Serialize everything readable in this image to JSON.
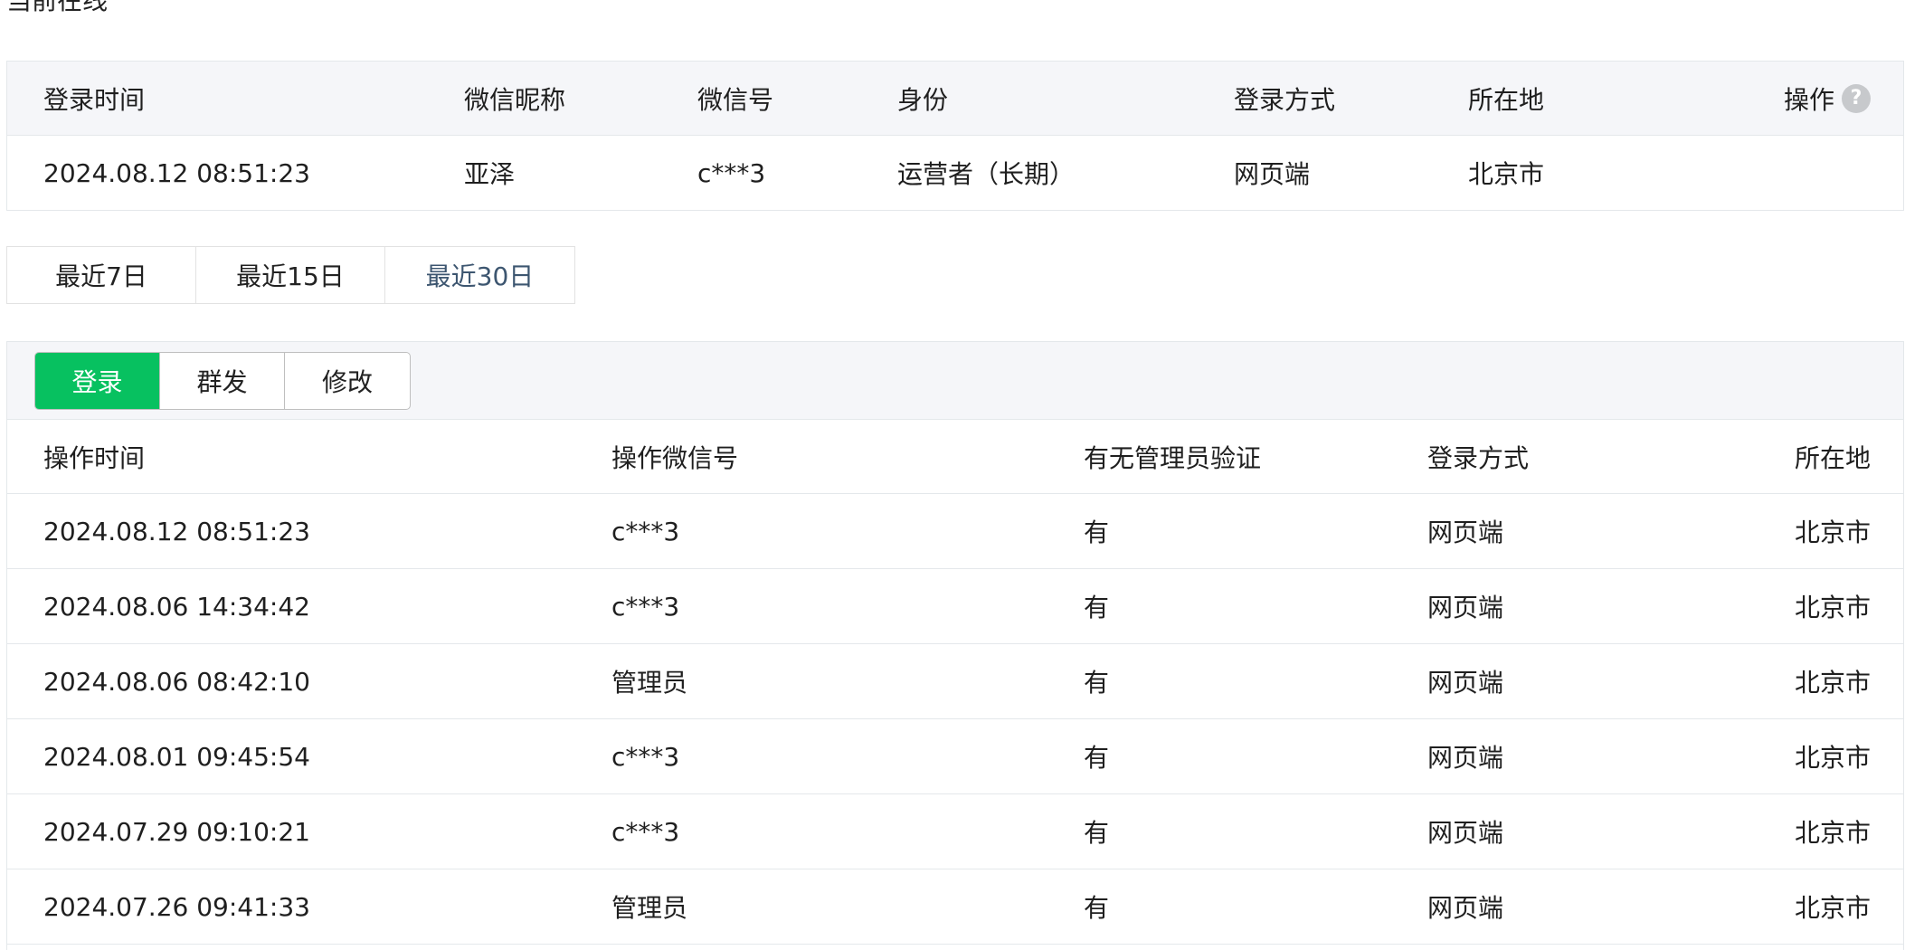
{
  "section": {
    "title": "当前在线"
  },
  "online": {
    "headers": {
      "login_time": "登录时间",
      "nickname": "微信昵称",
      "wechat_id": "微信号",
      "role": "身份",
      "login_method": "登录方式",
      "location": "所在地",
      "action": "操作",
      "help_glyph": "?"
    },
    "row": {
      "login_time": "2024.08.12 08:51:23",
      "nickname": "亚泽",
      "wechat_id": "c***3",
      "role": "运营者（长期）",
      "login_method": "网页端",
      "location": "北京市"
    }
  },
  "range_tabs": [
    "最近7日",
    "最近15日",
    "最近30日"
  ],
  "range_active": "最近30日",
  "log": {
    "types": [
      "登录",
      "群发",
      "修改"
    ],
    "type_active": "登录",
    "headers": {
      "time": "操作时间",
      "operator": "操作微信号",
      "admin_verify": "有无管理员验证",
      "method": "登录方式",
      "location": "所在地"
    },
    "rows": [
      {
        "time": "2024.08.12 08:51:23",
        "operator": "c***3",
        "admin_verify": "有",
        "method": "网页端",
        "location": "北京市"
      },
      {
        "time": "2024.08.06 14:34:42",
        "operator": "c***3",
        "admin_verify": "有",
        "method": "网页端",
        "location": "北京市"
      },
      {
        "time": "2024.08.06 08:42:10",
        "operator": "管理员",
        "admin_verify": "有",
        "method": "网页端",
        "location": "北京市"
      },
      {
        "time": "2024.08.01 09:45:54",
        "operator": "c***3",
        "admin_verify": "有",
        "method": "网页端",
        "location": "北京市"
      },
      {
        "time": "2024.07.29 09:10:21",
        "operator": "c***3",
        "admin_verify": "有",
        "method": "网页端",
        "location": "北京市"
      },
      {
        "time": "2024.07.26 09:41:33",
        "operator": "管理员",
        "admin_verify": "有",
        "method": "网页端",
        "location": "北京市"
      }
    ]
  },
  "colors": {
    "accent": "#07c160",
    "active_tab_text": "#3d5670",
    "header_bg": "#f5f6f9"
  }
}
